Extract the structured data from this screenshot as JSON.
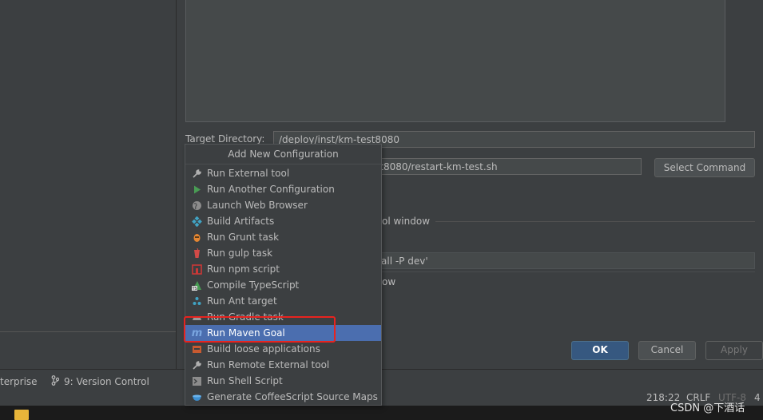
{
  "form": {
    "target_directory_label": "Target Directory:",
    "target_directory_value": "/deploy/inst/km-test8080",
    "command_value_visible": "st8080/restart-km-test.sh",
    "select_command_label": "Select Command",
    "tool_window_text": "ol window",
    "goal_value_visible": "all -P dev'",
    "show_text": "ow"
  },
  "buttons": {
    "ok": "OK",
    "cancel": "Cancel",
    "apply": "Apply"
  },
  "popup": {
    "title": "Add New Configuration",
    "items": [
      {
        "label": "Run External tool",
        "icon": "wrench-icon"
      },
      {
        "label": "Run Another Configuration",
        "icon": "play-icon"
      },
      {
        "label": "Launch Web Browser",
        "icon": "globe-icon"
      },
      {
        "label": "Build Artifacts",
        "icon": "artifacts-icon"
      },
      {
        "label": "Run Grunt task",
        "icon": "grunt-icon"
      },
      {
        "label": "Run gulp task",
        "icon": "gulp-icon"
      },
      {
        "label": "Run npm script",
        "icon": "npm-icon"
      },
      {
        "label": "Compile TypeScript",
        "icon": "typescript-icon"
      },
      {
        "label": "Run Ant target",
        "icon": "ant-icon"
      },
      {
        "label": "Run Gradle task",
        "icon": "gradle-icon"
      },
      {
        "label": "Run Maven Goal",
        "icon": "maven-icon",
        "selected": true
      },
      {
        "label": "Build loose applications",
        "icon": "loose-app-icon"
      },
      {
        "label": "Run Remote External tool",
        "icon": "wrench-icon"
      },
      {
        "label": "Run Shell Script",
        "icon": "terminal-icon"
      },
      {
        "label": "Generate CoffeeScript Source Maps",
        "icon": "coffee-icon"
      }
    ]
  },
  "statusbar": {
    "enterprise_tab": "terprise",
    "version_control_tab": "9: Version Control",
    "position": "218:22",
    "line_separator": "CRLF",
    "encoding": "UTF-8",
    "indent": "4"
  },
  "watermark": "CSDN @下酒话",
  "colors": {
    "selection": "#4b6eaf",
    "highlight_border": "#e8231f",
    "ok_button": "#365880"
  }
}
